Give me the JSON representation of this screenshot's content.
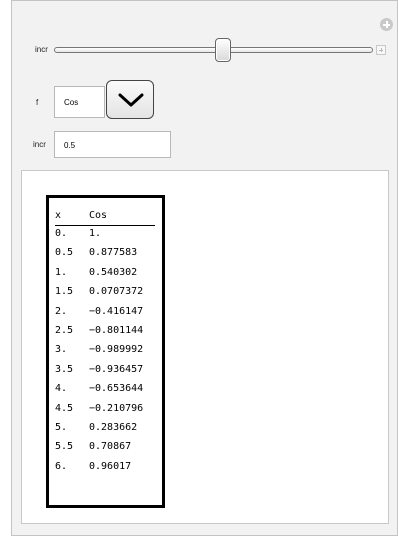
{
  "controls": {
    "slider_label": "incr",
    "slider_value_fraction": 0.53,
    "function_label": "f",
    "function_selected": "Cos",
    "input_label": "incr",
    "input_value": "0.5"
  },
  "table": {
    "header": {
      "x": "x",
      "value": "Cos"
    },
    "rows": [
      {
        "x": "0.",
        "value": "1."
      },
      {
        "x": "0.5",
        "value": "0.877583"
      },
      {
        "x": "1.",
        "value": "0.540302"
      },
      {
        "x": "1.5",
        "value": "0.0707372"
      },
      {
        "x": "2.",
        "value": "−0.416147"
      },
      {
        "x": "2.5",
        "value": "−0.801144"
      },
      {
        "x": "3.",
        "value": "−0.989992"
      },
      {
        "x": "3.5",
        "value": "−0.936457"
      },
      {
        "x": "4.",
        "value": "−0.653644"
      },
      {
        "x": "4.5",
        "value": "−0.210796"
      },
      {
        "x": "5.",
        "value": "0.283662"
      },
      {
        "x": "5.5",
        "value": "0.70867"
      },
      {
        "x": "6.",
        "value": "0.96017"
      }
    ]
  },
  "icons": {
    "corner": "plus-circle-icon",
    "slider_expand": "plus-square-icon",
    "dropdown": "chevron-down-icon"
  }
}
